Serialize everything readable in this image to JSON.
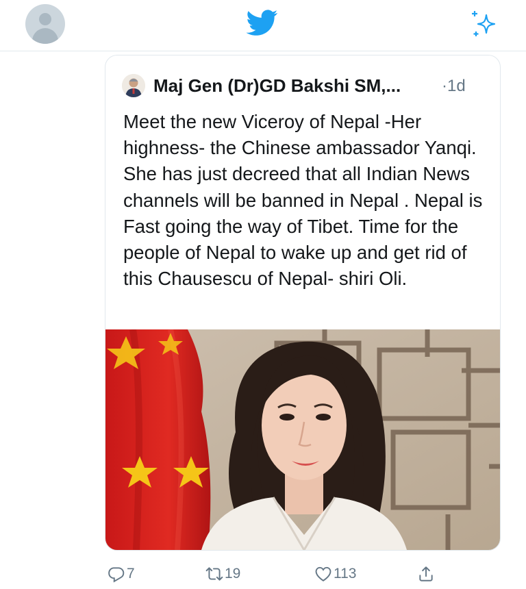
{
  "topbar": {
    "avatar_icon": "default-profile-icon",
    "logo_icon": "twitter-bird-icon",
    "sparkle_icon": "sparkle-icon",
    "brand_color": "#1da1f2"
  },
  "tweet": {
    "author_name": "Maj Gen (Dr)GD Bakshi SM,...",
    "time": "·1d",
    "text": "Meet the new Viceroy of Nepal -Her highness- the Chinese ambassador Yanqi. She has just decreed that all Indian News channels will be banned in Nepal . Nepal is Fast going the way of Tibet. Time for the people of Nepal to wake up and get rid of this Chausescu of Nepal- shiri Oli.",
    "media_icon": "photo-woman-with-flag"
  },
  "actions": {
    "reply_count": "7",
    "retweet_count": "19",
    "like_count": "113",
    "reply_icon": "reply-icon",
    "retweet_icon": "retweet-icon",
    "like_icon": "heart-icon",
    "share_icon": "share-icon"
  }
}
